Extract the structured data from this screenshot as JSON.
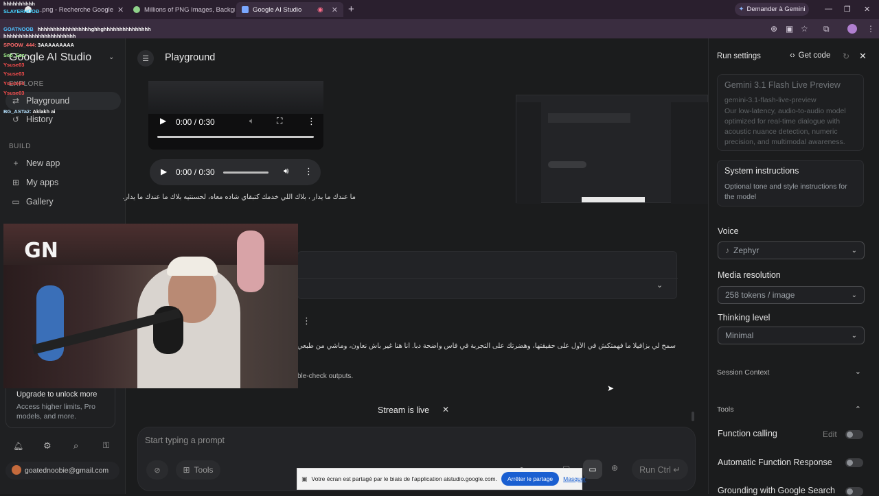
{
  "browser": {
    "tabs": [
      {
        "label": "…png - Recherche Google"
      },
      {
        "label": "Millions of PNG Images, Backgr…"
      },
      {
        "label": "Google AI Studio"
      }
    ],
    "new_tab_label": "+",
    "gemini_button": "Demander à Gemini"
  },
  "chat_overlay": [
    {
      "user": "SLAYERHOOD",
      "text": "",
      "color": "#46d4ff"
    },
    {
      "user": "",
      "text": "hhhhhhhhhh",
      "color": "#ffffff"
    },
    {
      "user": "GOATNOOB",
      "text": "hhhhhhhhhhhhhhhhhghhghhhhhhhhhhhhhhh",
      "color": "#ffffff"
    },
    {
      "user": "",
      "text": "hhhhhhhhhhhhhhhhhhhhhhh",
      "color": "#ffffff"
    },
    {
      "user": "SPOOW_444:",
      "text": "3AAAAAAAAA",
      "color": "#ff6b6b"
    },
    {
      "user": "Seb_Ezz:",
      "text": "",
      "color": "#9ff08a"
    },
    {
      "user": "Ysuse03",
      "text": "",
      "color": "#ff4f4f"
    },
    {
      "user": "Ysuse03",
      "text": "",
      "color": "#ff4f4f"
    },
    {
      "user": "Ysuse03",
      "text": "",
      "color": "#ff4f4f"
    },
    {
      "user": "Ysuse03",
      "text": "",
      "color": "#ff4f4f"
    },
    {
      "user": "BG_ASTa2:",
      "text": "Aklakh ai",
      "color": "#b6e2ff"
    }
  ],
  "sidebar": {
    "app_title": "Google AI Studio",
    "section_explore": "EXPLORE",
    "items_top": [
      {
        "label": "Playground",
        "icon": "playground-icon"
      },
      {
        "label": "History",
        "icon": "history-icon"
      }
    ],
    "section_build": "BUILD",
    "items_build": [
      {
        "label": "New app",
        "icon": "plus-icon"
      },
      {
        "label": "My apps",
        "icon": "apps-icon"
      },
      {
        "label": "Gallery",
        "icon": "gallery-icon"
      }
    ],
    "upgrade_title": "Upgrade to unlock more",
    "upgrade_text": "Access higher limits, Pro models, and more.",
    "account_email": "goatednoobie@gmail.com"
  },
  "header": {
    "title": "Playground"
  },
  "playground": {
    "video_time": "0:00 / 0:30",
    "audio_time": "0:00 / 0:30",
    "arabic_message_1": "ما عندك ما يدار ، بلاك اللي خدمك كتبقاي شاده معاه، لحسنتيه بلاك ما عندك ما يدار.",
    "arabic_message_2": "سمح لي بزافيلا ما فهمتكش في الأول على حقيقتها، وهضرتك على التجربة في فاس واضحة دبا. أنا هنا غير باش نعاون، وماشي من طبعي نضيع الو",
    "partial_note": "ble-check outputs.",
    "stream_status": "Stream is live",
    "prompt_placeholder": "Start typing a prompt",
    "tools_label": "Tools",
    "run_label": "Run Ctrl ↵"
  },
  "screen_share": {
    "message": "Votre écran est partagé par le biais de l'application aistudio.google.com.",
    "stop_button": "Arrêter le partage",
    "hide_link": "Masquer"
  },
  "webcam_overlay": {
    "logo_text": "GN"
  },
  "run_settings": {
    "title": "Run settings",
    "get_code": "Get code",
    "model_name": "Gemini 3.1 Flash Live Preview",
    "model_id": "gemini-3.1-flash-live-preview",
    "model_desc": "Our low-latency, audio-to-audio model optimized for real-time dialogue with acoustic nuance detection, numeric precision, and multimodal awareness.",
    "system_instructions_title": "System instructions",
    "system_instructions_desc": "Optional tone and style instructions for the model",
    "voice_label": "Voice",
    "voice_value": "Zephyr",
    "media_res_label": "Media resolution",
    "media_res_value": "258 tokens / image",
    "thinking_label": "Thinking level",
    "thinking_value": "Minimal",
    "session_context": "Session Context",
    "tools_section": "Tools",
    "function_calling": "Function calling",
    "edit_label": "Edit",
    "auto_function_response": "Automatic Function Response",
    "grounding": "Grounding with Google Search"
  }
}
